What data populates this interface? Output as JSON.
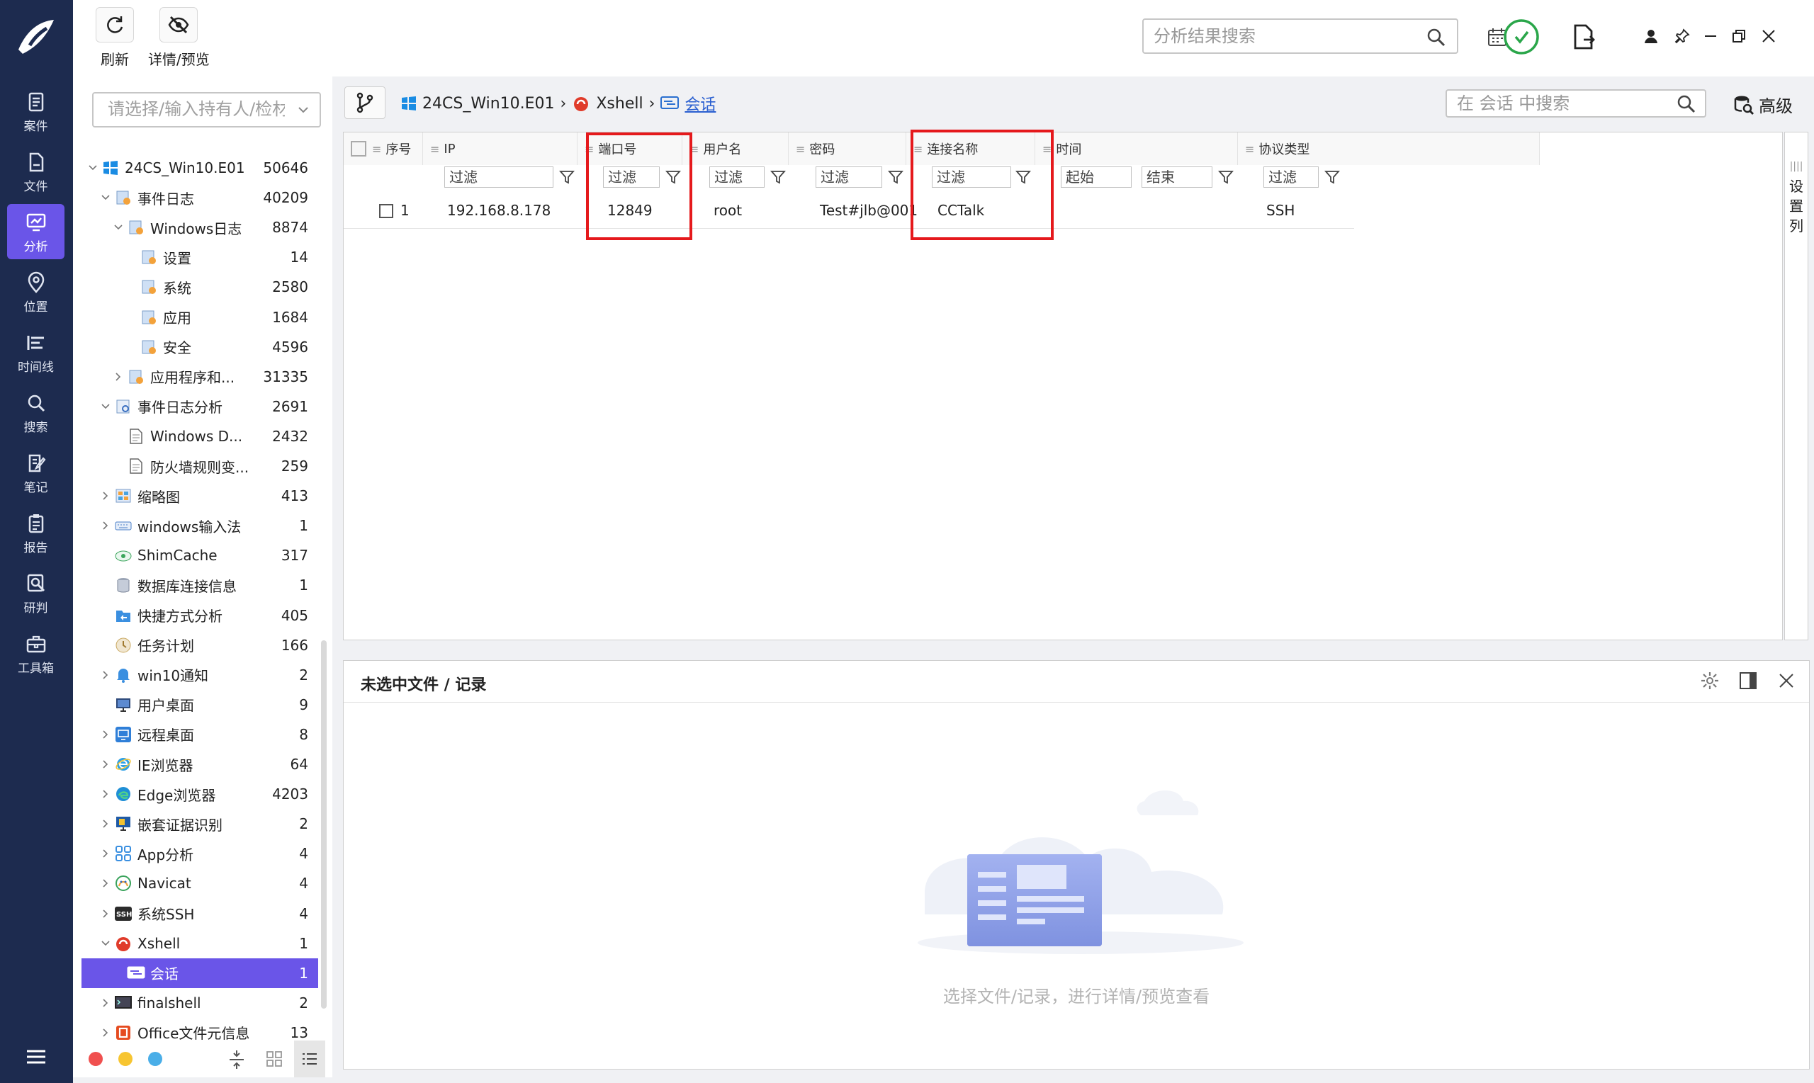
{
  "toolbar": {
    "refresh_label": "刷新",
    "details_label": "详情/预览",
    "search_placeholder": "分析结果搜索"
  },
  "nav": {
    "items": [
      {
        "label": "案件"
      },
      {
        "label": "文件"
      },
      {
        "label": "分析"
      },
      {
        "label": "位置"
      },
      {
        "label": "时间线"
      },
      {
        "label": "搜索"
      },
      {
        "label": "笔记"
      },
      {
        "label": "报告"
      },
      {
        "label": "研判"
      },
      {
        "label": "工具箱"
      }
    ],
    "active": "分析"
  },
  "tree": {
    "search_placeholder": "请选择/输入持有人/检材",
    "rows": [
      {
        "label": "24CS_Win10.E01",
        "count": "50646"
      },
      {
        "label": "事件日志",
        "count": "40209"
      },
      {
        "label": "Windows日志",
        "count": "8874"
      },
      {
        "label": "设置",
        "count": "14"
      },
      {
        "label": "系统",
        "count": "2580"
      },
      {
        "label": "应用",
        "count": "1684"
      },
      {
        "label": "安全",
        "count": "4596"
      },
      {
        "label": "应用程序和...",
        "count": "31335"
      },
      {
        "label": "事件日志分析",
        "count": "2691"
      },
      {
        "label": "Windows D...",
        "count": "2432"
      },
      {
        "label": "防火墙规则变...",
        "count": "259"
      },
      {
        "label": "缩略图",
        "count": "413"
      },
      {
        "label": "windows输入法",
        "count": "1"
      },
      {
        "label": "ShimCache",
        "count": "317"
      },
      {
        "label": "数据库连接信息",
        "count": "1"
      },
      {
        "label": "快捷方式分析",
        "count": "405"
      },
      {
        "label": "任务计划",
        "count": "166"
      },
      {
        "label": "win10通知",
        "count": "2"
      },
      {
        "label": "用户桌面",
        "count": "9"
      },
      {
        "label": "远程桌面",
        "count": "8"
      },
      {
        "label": "IE浏览器",
        "count": "64"
      },
      {
        "label": "Edge浏览器",
        "count": "4203"
      },
      {
        "label": "嵌套证据识别",
        "count": "2"
      },
      {
        "label": "App分析",
        "count": "4"
      },
      {
        "label": "Navicat",
        "count": "4"
      },
      {
        "label": "系统SSH",
        "count": "4"
      },
      {
        "label": "Xshell",
        "count": "1"
      },
      {
        "label": "会话",
        "count": "1"
      },
      {
        "label": "finalshell",
        "count": "2"
      },
      {
        "label": "Office文件元信息",
        "count": "13"
      }
    ]
  },
  "breadcrumb": {
    "source": "24CS_Win10.E01",
    "app": "Xshell",
    "current": "会话",
    "search_placeholder": "在 会话 中搜索",
    "advanced_label": "高级"
  },
  "table": {
    "columns": [
      "序号",
      "IP",
      "端口号",
      "用户名",
      "密码",
      "连接名称",
      "时间",
      "协议类型"
    ],
    "filter_placeholder": "过滤",
    "time_start": "起始",
    "time_end": "结束",
    "rows": [
      {
        "index": "1",
        "ip": "192.168.8.178",
        "port": "12849",
        "user": "root",
        "password": "Test#jlb@001",
        "name": "CCTalk",
        "time": "",
        "protocol": "SSH"
      }
    ],
    "side_label": "设置列"
  },
  "preview": {
    "title": "未选中文件 / 记录",
    "empty_text": "选择文件/记录，进行详情/预览查看"
  },
  "colors": {
    "rail": "#1d2b4f",
    "accent": "#6a55e8",
    "highlight": "#e5191c"
  }
}
